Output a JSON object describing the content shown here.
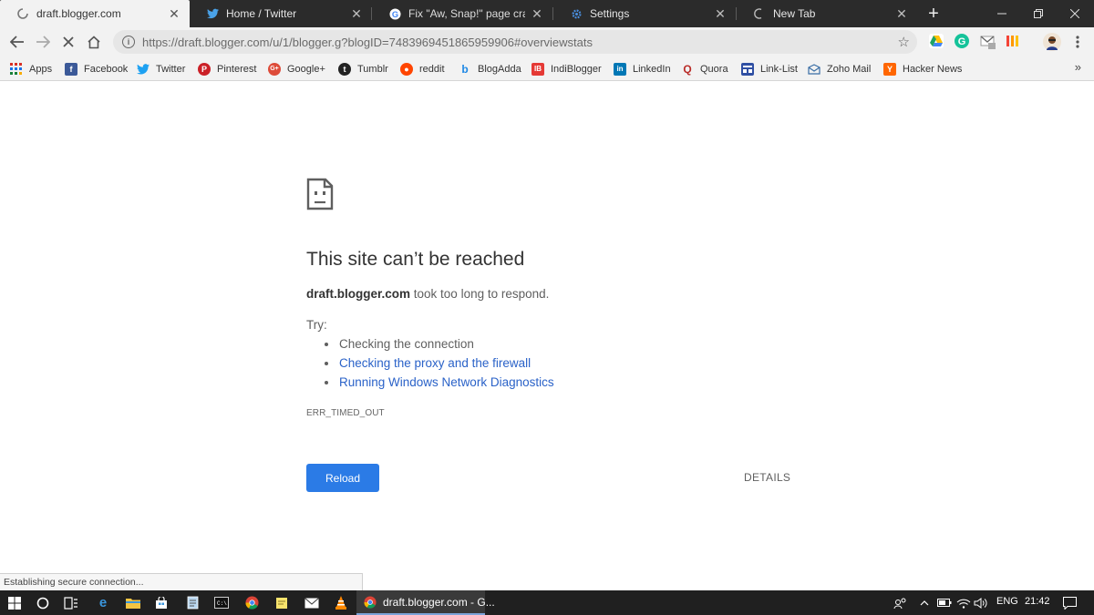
{
  "tabs": [
    {
      "title": "draft.blogger.com",
      "icon": "loading-spinner-icon",
      "active": true
    },
    {
      "title": "Home / Twitter",
      "icon": "twitter-icon",
      "active": false
    },
    {
      "title": "Fix \"Aw, Snap!\" page crashes a",
      "icon": "google-icon",
      "active": false
    },
    {
      "title": "Settings",
      "icon": "gear-icon",
      "active": false
    },
    {
      "title": "New Tab",
      "icon": "loading-spinner-icon",
      "active": false
    }
  ],
  "omnibox": {
    "url": "https://draft.blogger.com/u/1/blogger.g?blogID=7483969451865959906#overviewstats"
  },
  "bookmarks": [
    {
      "label": "Apps",
      "icon": "apps-grid-icon",
      "color": "#e53935"
    },
    {
      "label": "Facebook",
      "icon": "facebook-icon",
      "color": "#3b5998"
    },
    {
      "label": "Twitter",
      "icon": "twitter-icon",
      "color": "#1da1f2"
    },
    {
      "label": "Pinterest",
      "icon": "pinterest-icon",
      "color": "#cb2027"
    },
    {
      "label": "Google+",
      "icon": "google-plus-icon",
      "color": "#dd4b39"
    },
    {
      "label": "Tumblr",
      "icon": "tumblr-icon",
      "color": "#222222"
    },
    {
      "label": "reddit",
      "icon": "reddit-icon",
      "color": "#ff4500"
    },
    {
      "label": "BlogAdda",
      "icon": "blogadda-icon",
      "color": "#1e88e5"
    },
    {
      "label": "IndiBlogger",
      "icon": "indiblogger-icon",
      "color": "#e53935"
    },
    {
      "label": "LinkedIn",
      "icon": "linkedin-icon",
      "color": "#0077b5"
    },
    {
      "label": "Quora",
      "icon": "quora-icon",
      "color": "#b92b27"
    },
    {
      "label": "Link-List",
      "icon": "link-list-icon",
      "color": "#2f4fa3"
    },
    {
      "label": "Zoho Mail",
      "icon": "zoho-mail-icon",
      "color": "#3a6ea5"
    },
    {
      "label": "Hacker News",
      "icon": "hacker-news-icon",
      "color": "#ff6600"
    }
  ],
  "error": {
    "title": "This site can’t be reached",
    "host": "draft.blogger.com",
    "desc_rest": "took too long to respond.",
    "try_label": "Try:",
    "suggestions": [
      "Checking the connection",
      "Checking the proxy and the firewall",
      "Running Windows Network Diagnostics"
    ],
    "code": "ERR_TIMED_OUT",
    "reload_label": "Reload",
    "details_label": "DETAILS",
    "accent": "#2b7be6"
  },
  "status": "Establishing secure connection...",
  "taskbar": {
    "active_app": "draft.blogger.com - G...",
    "language": "ENG",
    "time": "21:42"
  }
}
